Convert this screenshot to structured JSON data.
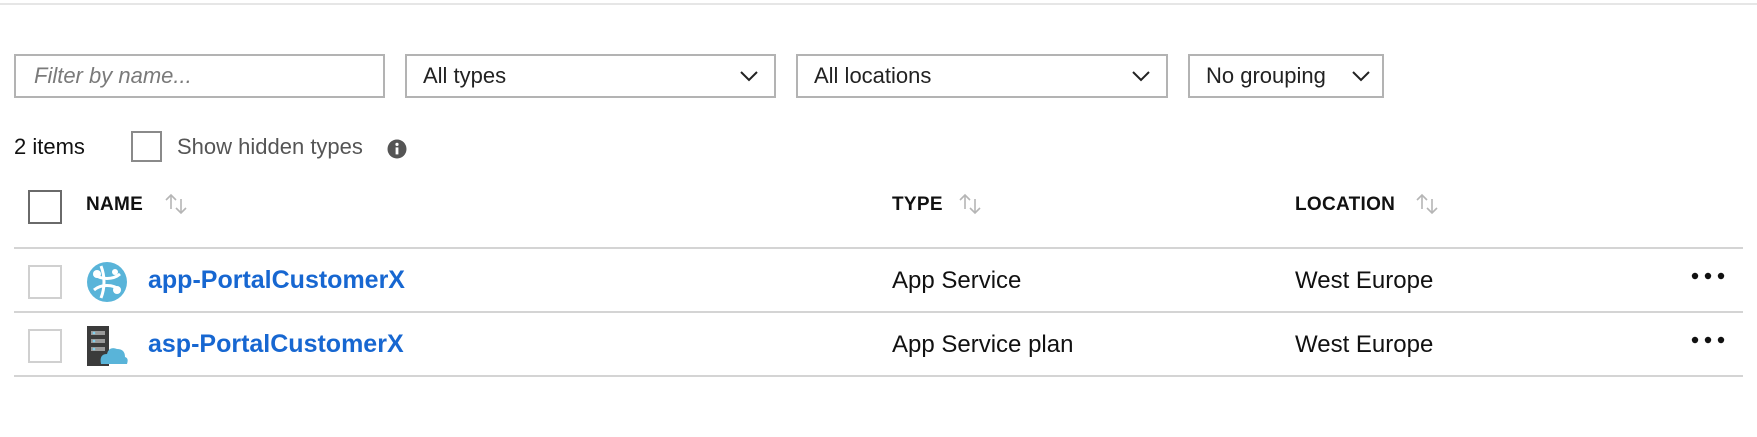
{
  "filters": {
    "name_placeholder": "Filter by name...",
    "types_selected": "All types",
    "locations_selected": "All locations",
    "grouping_selected": "No grouping"
  },
  "summary": {
    "items_count": "2 items",
    "show_hidden_label": "Show hidden types"
  },
  "table": {
    "columns": [
      "NAME",
      "TYPE",
      "LOCATION"
    ],
    "rows": [
      {
        "name": "app-PortalCustomerX",
        "type": "App Service",
        "location": "West Europe",
        "icon": "app-service-icon"
      },
      {
        "name": "asp-PortalCustomerX",
        "type": "App Service plan",
        "location": "West Europe",
        "icon": "app-service-plan-icon"
      }
    ]
  },
  "colors": {
    "link": "#1767d1",
    "border": "#b3b3b3",
    "divider": "#d4d4d4",
    "icon_blue": "#59b4d9",
    "icon_dark": "#3b3b3b"
  }
}
